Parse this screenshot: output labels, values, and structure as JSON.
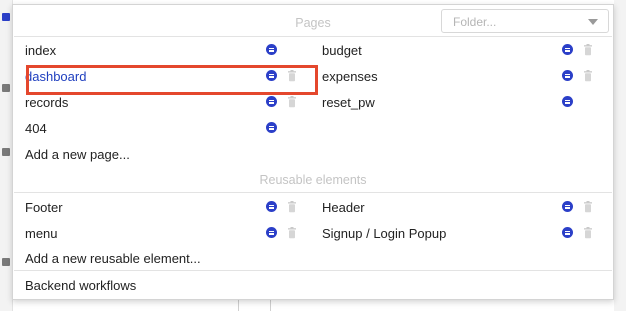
{
  "folder_select": {
    "placeholder": "Folder..."
  },
  "pages_section": {
    "title": "Pages",
    "left_items": [
      {
        "label": "index",
        "icons": [
          "options-icon"
        ]
      },
      {
        "label": "dashboard",
        "icons": [
          "options-icon",
          "trash-icon"
        ],
        "selected": true
      },
      {
        "label": "records",
        "icons": [
          "options-icon",
          "trash-icon"
        ]
      },
      {
        "label": "404",
        "icons": [
          "options-icon"
        ]
      }
    ],
    "right_items": [
      {
        "label": "budget",
        "icons": [
          "options-icon",
          "trash-icon"
        ]
      },
      {
        "label": "expenses",
        "icons": [
          "options-icon",
          "trash-icon"
        ]
      },
      {
        "label": "reset_pw",
        "icons": [
          "options-icon"
        ]
      }
    ],
    "add_label": "Add a new page..."
  },
  "reusable_section": {
    "title": "Reusable elements",
    "left_items": [
      {
        "label": "Footer",
        "icons": [
          "options-icon",
          "trash-icon"
        ]
      },
      {
        "label": "menu",
        "icons": [
          "options-icon",
          "trash-icon"
        ]
      }
    ],
    "right_items": [
      {
        "label": "Header",
        "icons": [
          "options-icon",
          "trash-icon"
        ]
      },
      {
        "label": "Signup / Login Popup",
        "icons": [
          "options-icon",
          "trash-icon"
        ]
      }
    ],
    "add_label": "Add a new reusable element..."
  },
  "backend_label": "Backend workflows",
  "colors": {
    "accent_blue": "#2b3fc8",
    "selected_text": "#1f3fbf",
    "highlight_red": "#e4472d",
    "muted_title": "#c4c4c4"
  }
}
